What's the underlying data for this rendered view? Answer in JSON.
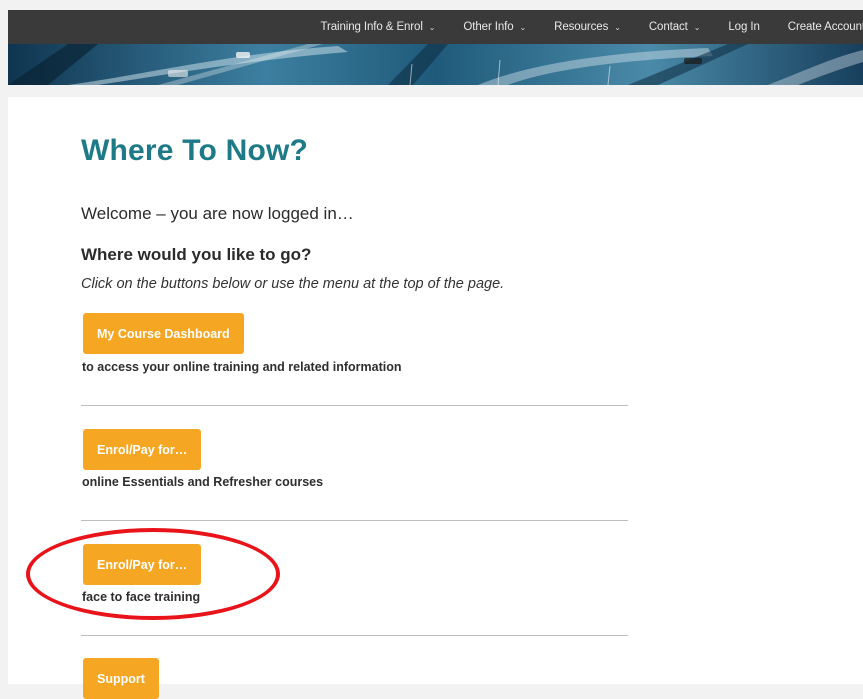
{
  "nav": {
    "items": [
      {
        "label": "Training Info & Enrol",
        "dropdown": true
      },
      {
        "label": "Other Info",
        "dropdown": true
      },
      {
        "label": "Resources",
        "dropdown": true
      },
      {
        "label": "Contact",
        "dropdown": true
      },
      {
        "label": "Log In",
        "dropdown": false
      },
      {
        "label": "Create Account",
        "dropdown": false
      }
    ],
    "chevron": "⌄"
  },
  "page": {
    "title": "Where To Now?",
    "welcome": "Welcome – you are now logged in…",
    "subheading": "Where would you like to go?",
    "instruction": "Click on the buttons below or use the menu at the top of the page."
  },
  "sections": [
    {
      "button": "My Course Dashboard",
      "description": "to access your online training and related information"
    },
    {
      "button": "Enrol/Pay for…",
      "description": "online Essentials and Refresher courses"
    },
    {
      "button": "Enrol/Pay for…",
      "description": "face to face training"
    },
    {
      "button": "Support",
      "description": ""
    }
  ],
  "colors": {
    "title": "#1d7a86",
    "button": "#f5a623",
    "navbar": "#3a3a3a",
    "annotation": "#e8141a"
  }
}
